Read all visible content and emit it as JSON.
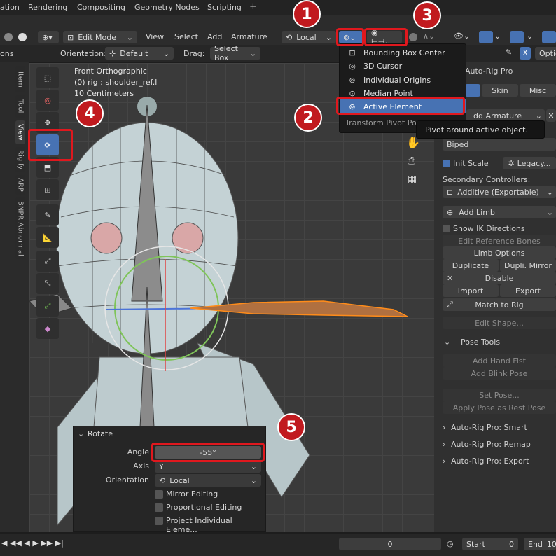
{
  "topbar": {
    "tabs": [
      "ation",
      "Rendering",
      "Compositing",
      "Geometry Nodes",
      "Scripting",
      "+"
    ]
  },
  "header": {
    "mode": "Edit Mode",
    "menus": [
      "View",
      "Select",
      "Add",
      "Armature"
    ],
    "transform_orientation": "Local"
  },
  "subheader": {
    "left_label": "ons",
    "orientation_label": "Orientation:",
    "orientation_value": "Default",
    "drag_label": "Drag:",
    "drag_value": "Select Box",
    "options_label": "Optio",
    "x_label": "X"
  },
  "viewport": {
    "view_name": "Front Orthographic",
    "object_name": "(0) rig : shoulder_ref.l",
    "scale": "10 Centimeters"
  },
  "side_tabs": [
    "Item",
    "Tool",
    "View",
    "Rigify",
    "ARP",
    "BNPR Abnormal"
  ],
  "pivot_menu": {
    "items": [
      {
        "label": "Bounding Box Center",
        "icon": "bounding-box-icon"
      },
      {
        "label": "3D Cursor",
        "icon": "cursor-icon"
      },
      {
        "label": "Individual Origins",
        "icon": "individual-origins-icon"
      },
      {
        "label": "Median Point",
        "icon": "median-point-icon"
      },
      {
        "label": "Active Element",
        "icon": "active-element-icon"
      }
    ],
    "title": "Transform Pivot Poin",
    "tooltip": "Pivot around active object."
  },
  "right_panel": {
    "title": "Auto-Rig Pro",
    "tabs": [
      "Skin",
      "Misc"
    ],
    "add_armature": "dd Armature",
    "biped": "Biped",
    "init_scale": "Init Scale",
    "legacy": "Legacy...",
    "secondary_label": "Secondary Controllers:",
    "secondary_value": "Additive (Exportable)",
    "add_limb": "Add Limb",
    "show_ik": "Show IK Directions",
    "edit_ref": "Edit Reference Bones",
    "limb_options": "Limb Options",
    "duplicate": "Duplicate",
    "dupli_mirror": "Dupli. Mirror",
    "disable": "Disable",
    "import": "Import",
    "export": "Export",
    "match_rig": "Match to Rig",
    "edit_shape": "Edit Shape...",
    "pose_tools": "Pose Tools",
    "add_hand_fist": "Add Hand Fist",
    "add_blink_pose": "Add Blink Pose",
    "set_pose": "Set Pose...",
    "apply_pose": "Apply Pose as Rest Pose",
    "smart": "Auto-Rig Pro: Smart",
    "remap": "Auto-Rig Pro: Remap",
    "export_panel": "Auto-Rig Pro: Export"
  },
  "operator_panel": {
    "title": "Rotate",
    "angle_label": "Angle",
    "angle_value": "-55°",
    "axis_label": "Axis",
    "axis_value": "Y",
    "orientation_label": "Orientation",
    "orientation_value": "Local",
    "mirror": "Mirror Editing",
    "proportional": "Proportional Editing",
    "project": "Project Individual Eleme..."
  },
  "timeline": {
    "current_frame": "0",
    "start_label": "Start",
    "start_value": "0",
    "end_label": "End",
    "end_value": "10"
  },
  "annotations": [
    "1",
    "2",
    "3",
    "4",
    "5"
  ],
  "colors": {
    "accent": "#4772b3",
    "annotation": "#e0181e"
  }
}
